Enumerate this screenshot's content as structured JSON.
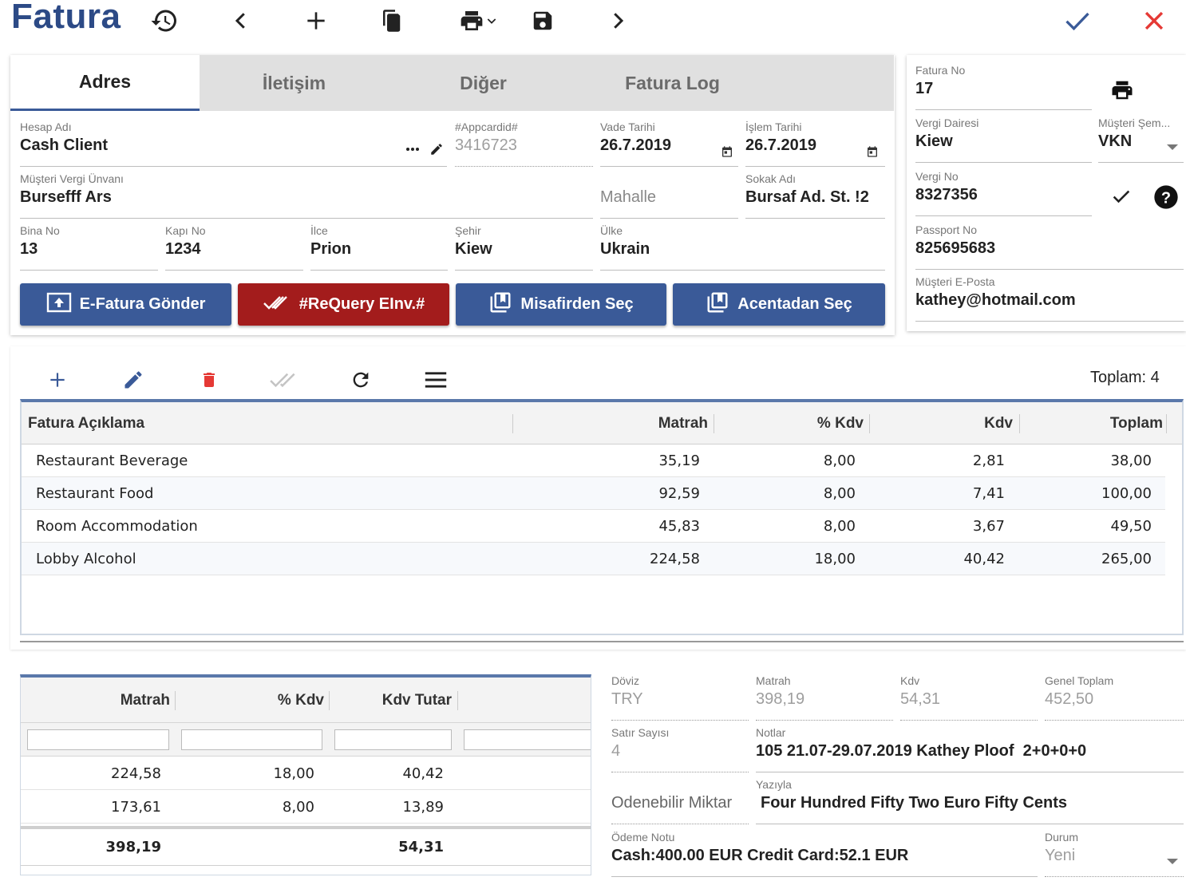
{
  "app": {
    "title": "Fatura"
  },
  "colors": {
    "brand": "#2c4a86",
    "button_blue": "#3a5a98",
    "button_red": "#a31c1c",
    "confirm": "#3a5a98",
    "cancel": "#e53935",
    "delete": "#e53935"
  },
  "toolbar": {
    "icons": [
      "history-icon",
      "chevron-left-icon",
      "add-icon",
      "copy-icon",
      "print-icon",
      "save-icon",
      "chevron-right-icon",
      "check-icon",
      "close-icon"
    ]
  },
  "tabs": [
    {
      "label": "Adres",
      "active": true
    },
    {
      "label": "İletişim",
      "active": false
    },
    {
      "label": "Diğer",
      "active": false
    },
    {
      "label": "Fatura Log",
      "active": false
    }
  ],
  "address": {
    "hesap_adi": {
      "label": "Hesap Adı",
      "value": "Cash Client"
    },
    "appcardid": {
      "label": "#Appcardid#",
      "value": "3416723"
    },
    "vade_tarihi": {
      "label": "Vade Tarihi",
      "value": "26.7.2019"
    },
    "islem_tarihi": {
      "label": "İşlem Tarihi",
      "value": "26.7.2019"
    },
    "musteri_vergi_unvani": {
      "label": "Müşteri Vergi Ünvanı",
      "value": "Bursefff Ars"
    },
    "mahalle": {
      "placeholder": "Mahalle"
    },
    "sokak_adi": {
      "label": "Sokak Adı",
      "value": "Bursaf Ad. St. !2"
    },
    "bina_no": {
      "label": "Bina No",
      "value": "13"
    },
    "kapi_no": {
      "label": "Kapı No",
      "value": "1234"
    },
    "ilce": {
      "label": "İlce",
      "value": "Prion"
    },
    "sehir": {
      "label": "Şehir",
      "value": "Kiew"
    },
    "ulke": {
      "label": "Ülke",
      "value": "Ukrain"
    }
  },
  "actions": {
    "efatura": "E-Fatura Gönder",
    "requery": "#ReQuery EInv.#",
    "misafirden": "Misafirden Seç",
    "acentadan": "Acentadan Seç"
  },
  "invoice_info": {
    "fatura_no": {
      "label": "Fatura No",
      "value": "17"
    },
    "vergi_dairesi": {
      "label": "Vergi Dairesi",
      "value": "Kiew"
    },
    "musteri_sema": {
      "label": "Müşteri Şem...",
      "value": "VKN"
    },
    "vergi_no": {
      "label": "Vergi No",
      "value": "8327356"
    },
    "passport_no": {
      "label": "Passport No",
      "value": "825695683"
    },
    "musteri_eposta": {
      "label": "Müşteri E-Posta",
      "value": "kathey@hotmail.com"
    }
  },
  "grid": {
    "total_label": "Toplam: 4",
    "columns": [
      "Fatura Açıklama",
      "Matrah",
      "% Kdv",
      "Kdv",
      "Toplam"
    ],
    "rows": [
      {
        "aciklama": "Restaurant Beverage",
        "matrah": "35,19",
        "kdv_pct": "8,00",
        "kdv": "2,81",
        "toplam": "38,00"
      },
      {
        "aciklama": "Restaurant Food",
        "matrah": "92,59",
        "kdv_pct": "8,00",
        "kdv": "7,41",
        "toplam": "100,00"
      },
      {
        "aciklama": "Room Accommodation",
        "matrah": "45,83",
        "kdv_pct": "8,00",
        "kdv": "3,67",
        "toplam": "49,50"
      },
      {
        "aciklama": "Lobby Alcohol",
        "matrah": "224,58",
        "kdv_pct": "18,00",
        "kdv": "40,42",
        "toplam": "265,00"
      }
    ]
  },
  "summary": {
    "columns": [
      "Matrah",
      "% Kdv",
      "Kdv Tutar"
    ],
    "rows": [
      {
        "matrah": "224,58",
        "kdv_pct": "18,00",
        "kdv_tutar": "40,42"
      },
      {
        "matrah": "173,61",
        "kdv_pct": "8,00",
        "kdv_tutar": "13,89"
      }
    ],
    "total": {
      "matrah": "398,19",
      "kdv_tutar": "54,31"
    }
  },
  "totals": {
    "doviz": {
      "label": "Döviz",
      "value": "TRY"
    },
    "matrah": {
      "label": "Matrah",
      "value": "398,19"
    },
    "kdv": {
      "label": "Kdv",
      "value": "54,31"
    },
    "genel_toplam": {
      "label": "Genel Toplam",
      "value": "452,50"
    },
    "satir_sayisi": {
      "label": "Satır Sayısı",
      "value": "4"
    },
    "notlar": {
      "label": "Notlar",
      "value": "105 21.07-29.07.2019 Kathey Ploof  2+0+0+0"
    },
    "odenebilir_miktar": {
      "label": "Odenebilir Miktar"
    },
    "yaziyla": {
      "label": "Yazıyla",
      "value": "Four Hundred Fifty Two Euro Fifty Cents"
    },
    "odeme_notu": {
      "label": "Ödeme Notu",
      "value": "Cash:400.00 EUR Credit Card:52.1 EUR"
    },
    "durum": {
      "label": "Durum",
      "value": "Yeni"
    }
  }
}
